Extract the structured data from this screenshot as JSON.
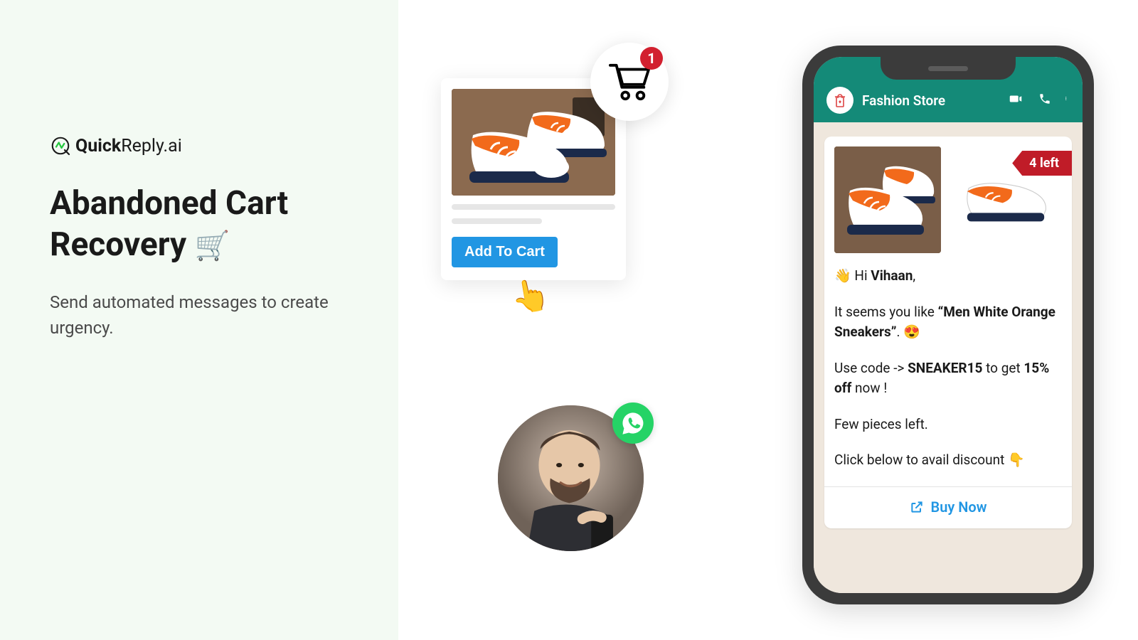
{
  "logo": {
    "brand_bold": "Quick",
    "brand_rest": "Reply.ai"
  },
  "headline_line1": "Abandoned Cart",
  "headline_line2": "Recovery",
  "headline_emoji": "🛒",
  "subhead": "Send automated messages to create urgency.",
  "product_card": {
    "add_to_cart_label": "Add To Cart",
    "cart_count": "1"
  },
  "tap_emoji": "👆",
  "phone": {
    "store_name": "Fashion Store",
    "stock_ribbon": "4 left",
    "greeting_wave": "👋",
    "greeting_prefix": "Hi ",
    "greeting_name": "Vihaan",
    "greeting_suffix": ",",
    "line2_a": "It seems you like ",
    "line2_b_quote_open": "“",
    "line2_b_product": "Men White Orange Sneakers",
    "line2_b_quote_close": "”",
    "line2_c": ". ",
    "line2_emoji": "😍",
    "line3_a": "Use code -> ",
    "line3_code": "SNEAKER15",
    "line3_b": " to get ",
    "line3_discount": "15% off",
    "line3_c": " now !",
    "line4": "Few pieces left.",
    "line5_a": "Click below to avail discount ",
    "line5_emoji": "👇",
    "buy_now": "Buy Now"
  }
}
